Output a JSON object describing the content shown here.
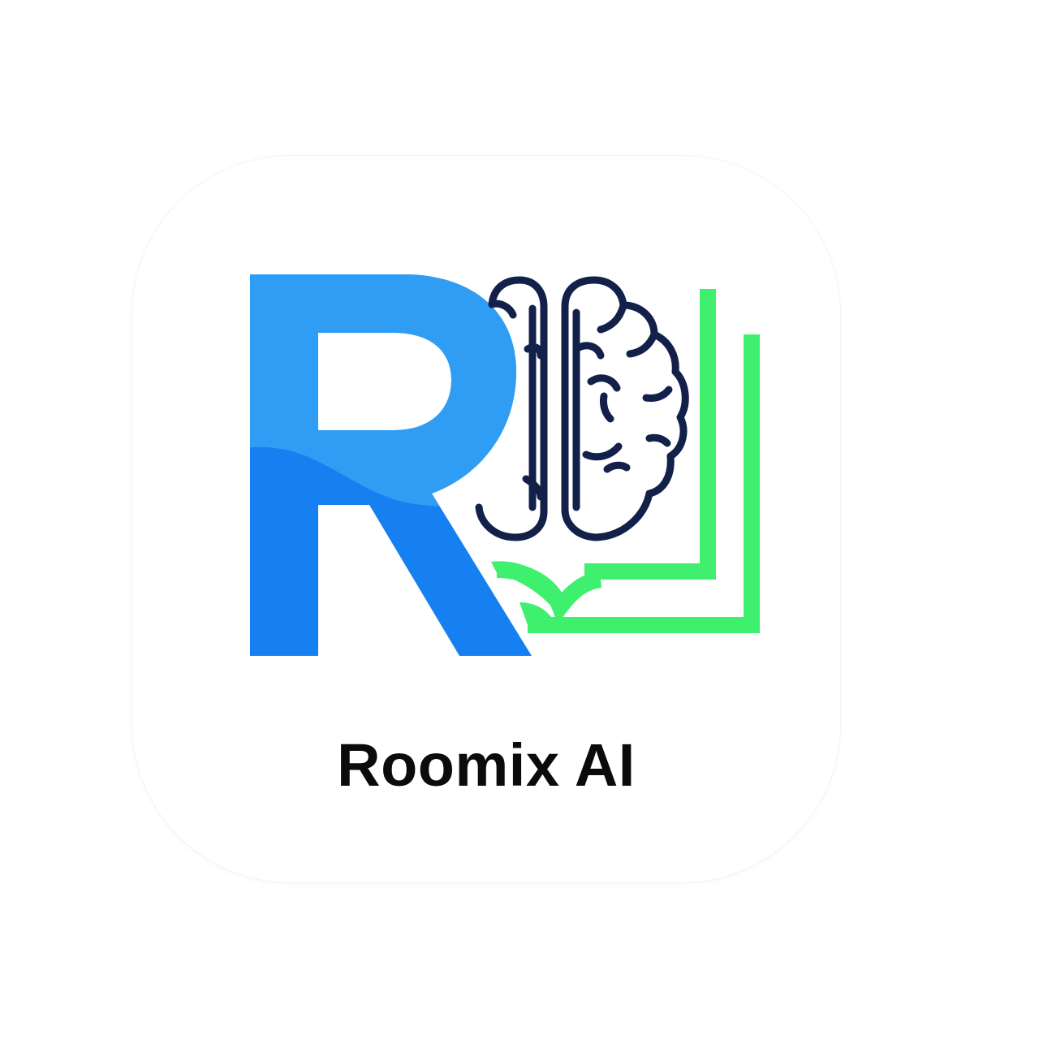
{
  "app": {
    "name": "Roomix AI",
    "logo_icon": "roomix-r-brain-book-logo"
  },
  "colors": {
    "letter_blue_light": "#2f9df4",
    "letter_blue_dark": "#1680f0",
    "brain_stroke": "#13214a",
    "book_green": "#3ef06d",
    "text": "#0b0b0b",
    "background": "#ffffff"
  }
}
